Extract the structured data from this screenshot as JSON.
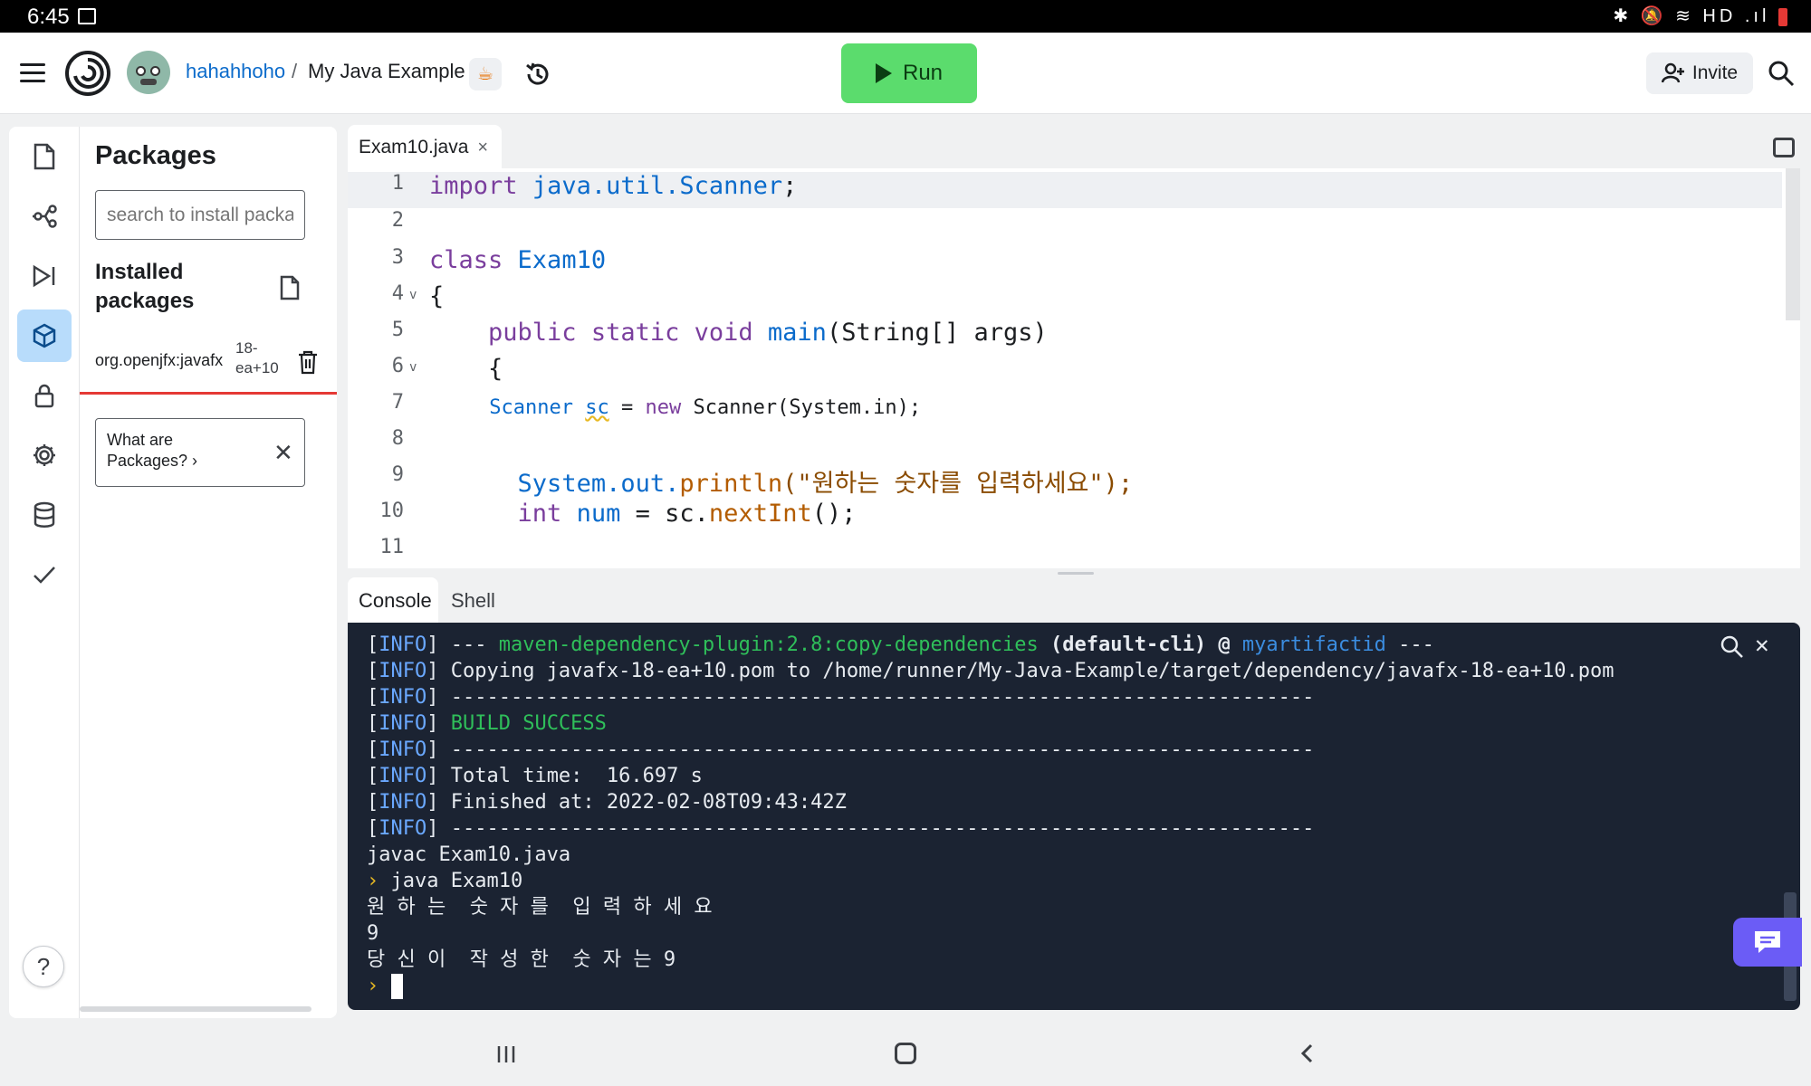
{
  "status_bar": {
    "time": "6:45",
    "right_icons": "✱ 🔕 ≋ HD .ıl"
  },
  "header": {
    "user": "hahahhoho",
    "separator": "/",
    "repl_name": "My Java Example",
    "lang_badge": "☕",
    "run_label": "Run",
    "invite_label": "Invite"
  },
  "packages": {
    "title": "Packages",
    "search_placeholder": "search to install packages",
    "installed_label": "Installed packages",
    "items": [
      {
        "name": "org.openjfx:javafx",
        "version": "18-ea+10"
      }
    ],
    "help_card": "What are Packages? ›"
  },
  "editor": {
    "tab_name": "Exam10.java",
    "tab_close": "×",
    "lines": [
      {
        "n": "1",
        "fold": ""
      },
      {
        "n": "2",
        "fold": ""
      },
      {
        "n": "3",
        "fold": ""
      },
      {
        "n": "4",
        "fold": "v"
      },
      {
        "n": "5",
        "fold": ""
      },
      {
        "n": "6",
        "fold": "v"
      },
      {
        "n": "7",
        "fold": ""
      },
      {
        "n": "8",
        "fold": ""
      },
      {
        "n": "9",
        "fold": ""
      },
      {
        "n": "10",
        "fold": ""
      },
      {
        "n": "11",
        "fold": ""
      }
    ],
    "code": {
      "l1_kw": "import",
      "l1_pkg": "java.util.Scanner",
      "l1_end": ";",
      "l3_kw": "class",
      "l3_name": "Exam10",
      "l4": "{",
      "l5_mods": "public static void",
      "l5_fn": "main",
      "l5_args": "(String[] args)",
      "l6": "{",
      "l7_type": "Scanner",
      "l7_var": "sc",
      "l7_rest": " = ",
      "l7_new": "new",
      "l7_ctor": "Scanner(System.in);",
      "l9_obj": "System.out.",
      "l9_fn": "println",
      "l9_str": "(\"원하는 숫자를 입력하세요\");",
      "l10_kw": "int",
      "l10_var": "num",
      "l10_eq": " = sc.",
      "l10_fn": "nextInt",
      "l10_end": "();"
    }
  },
  "console": {
    "tab_console": "Console",
    "tab_shell": "Shell",
    "info_tag": "INFO",
    "lines": {
      "l1_a": " --- ",
      "l1_plugin": "maven-dependency-plugin:2.8:copy-dependencies",
      "l1_b": " (default-cli) @ ",
      "l1_art": "myartifactid",
      "l1_c": " ---",
      "l2": " Copying javafx-18-ea+10.pom to /home/runner/My-Java-Example/target/dependency/javafx-18-ea+10.pom",
      "dash": " ------------------------------------------------------------------------",
      "l4": " BUILD SUCCESS",
      "l6": " Total time:  16.697 s",
      "l7": " Finished at: 2022-02-08T09:43:42Z",
      "javac": "javac Exam10.java",
      "prompt": "›",
      "java": " java Exam10",
      "out1": "원 하 는  숫 자 를  입 력 하 세 요",
      "out2": "9",
      "out3": "당 신 이  작 성 한  숫 자 는 9"
    }
  },
  "colors": {
    "run": "#5bdc6d",
    "console_bg": "#1b2332",
    "active_rail": "#b8dcfb",
    "chat": "#6b5cf6"
  }
}
